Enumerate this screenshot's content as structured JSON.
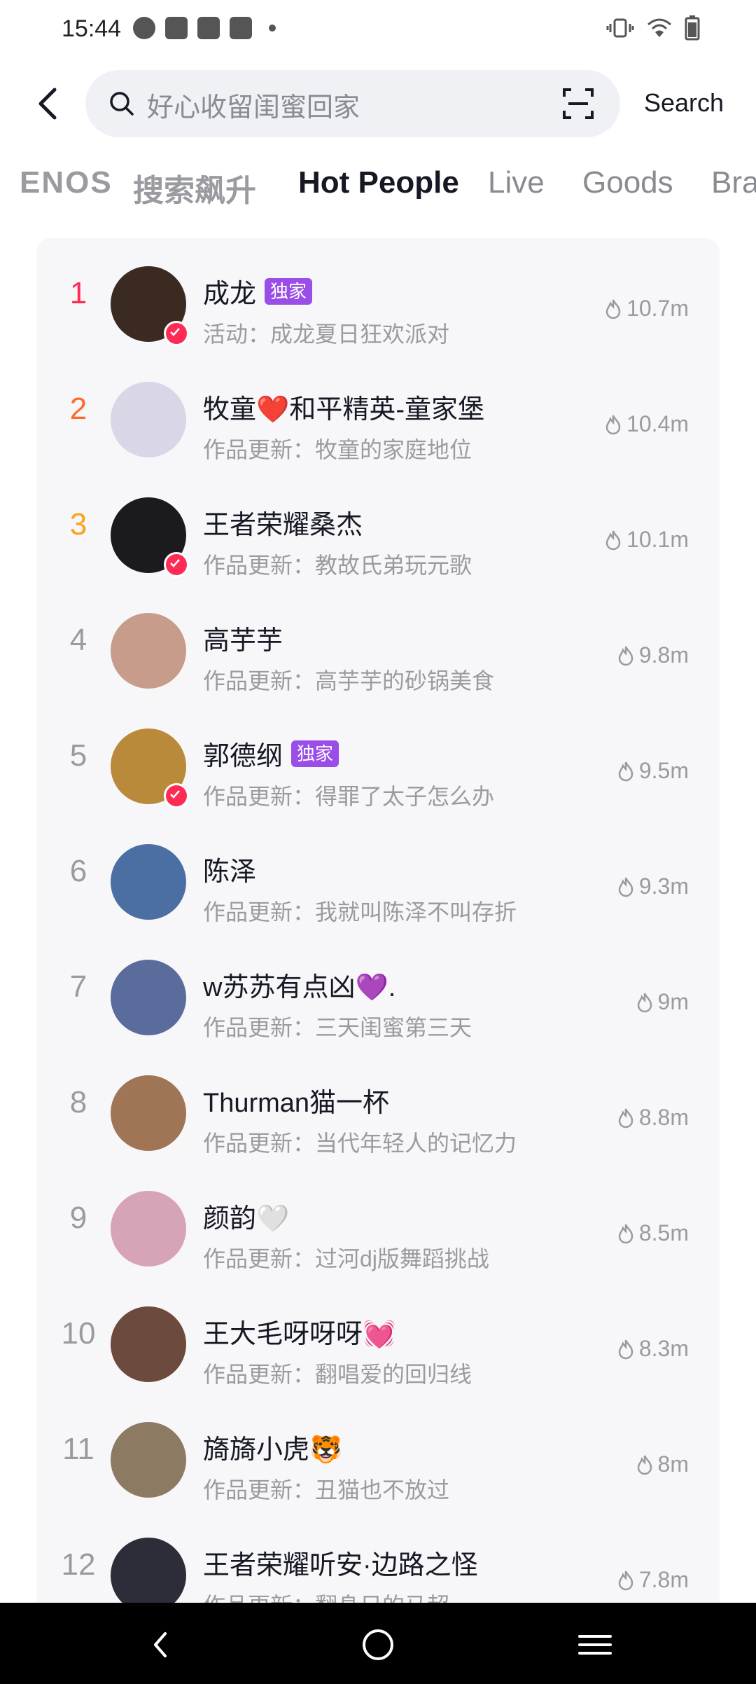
{
  "status_bar": {
    "time": "15:44"
  },
  "search": {
    "query": "好心收留闺蜜回家",
    "button": "Search"
  },
  "tabs": [
    {
      "label": "ENOS"
    },
    {
      "label": "搜索飙升"
    },
    {
      "label": "Hot People"
    },
    {
      "label": "Live"
    },
    {
      "label": "Goods"
    },
    {
      "label": "Bra"
    }
  ],
  "list": [
    {
      "rank": "1",
      "name": "成龙",
      "badge": "独家",
      "desc": "活动：成龙夏日狂欢派对",
      "heat": "10.7m",
      "avatar_color": "#3a2a22"
    },
    {
      "rank": "2",
      "name": "牧童❤️和平精英-童家堡",
      "desc": "作品更新：牧童的家庭地位",
      "heat": "10.4m",
      "avatar_color": "#d9d6e8"
    },
    {
      "rank": "3",
      "name": "王者荣耀桑杰",
      "desc": "作品更新：教故氏弟玩元歌",
      "heat": "10.1m",
      "avatar_color": "#1b1b1f"
    },
    {
      "rank": "4",
      "name": "高芋芋",
      "desc": "作品更新：高芋芋的砂锅美食",
      "heat": "9.8m",
      "avatar_color": "#c89c8a"
    },
    {
      "rank": "5",
      "name": "郭德纲",
      "badge": "独家",
      "desc": "作品更新：得罪了太子怎么办",
      "heat": "9.5m",
      "avatar_color": "#b88a3a"
    },
    {
      "rank": "6",
      "name": "陈泽",
      "desc": "作品更新：我就叫陈泽不叫存折",
      "heat": "9.3m",
      "avatar_color": "#4b6fa3"
    },
    {
      "rank": "7",
      "name": "w苏苏有点凶💜.",
      "desc": "作品更新：三天闺蜜第三天",
      "heat": "9m",
      "avatar_color": "#5a6c9c"
    },
    {
      "rank": "8",
      "name": "Thurman猫一杯",
      "desc": "作品更新：当代年轻人的记忆力",
      "heat": "8.8m",
      "avatar_color": "#a07556"
    },
    {
      "rank": "9",
      "name": "颜韵🤍",
      "desc": "作品更新：过河dj版舞蹈挑战",
      "heat": "8.5m",
      "avatar_color": "#d7a3b6"
    },
    {
      "rank": "10",
      "name": "王大毛呀呀呀💓",
      "desc": "作品更新：翻唱爱的回归线",
      "heat": "8.3m",
      "avatar_color": "#6c4a3d"
    },
    {
      "rank": "11",
      "name": "旖旖小虎🐯",
      "desc": "作品更新：丑猫也不放过",
      "heat": "8m",
      "avatar_color": "#8c7a63"
    },
    {
      "rank": "12",
      "name": "王者荣耀听安·边路之怪",
      "desc": "作品更新：翻身日的马超",
      "heat": "7.8m",
      "avatar_color": "#2d2d3a"
    }
  ],
  "colors": {
    "primary_text": "#161823",
    "secondary_text": "#9a9ba0",
    "rank1": "#fe2c55",
    "rank2": "#ff6a2b",
    "rank3": "#fba21b",
    "badge": "#9b4de8"
  }
}
